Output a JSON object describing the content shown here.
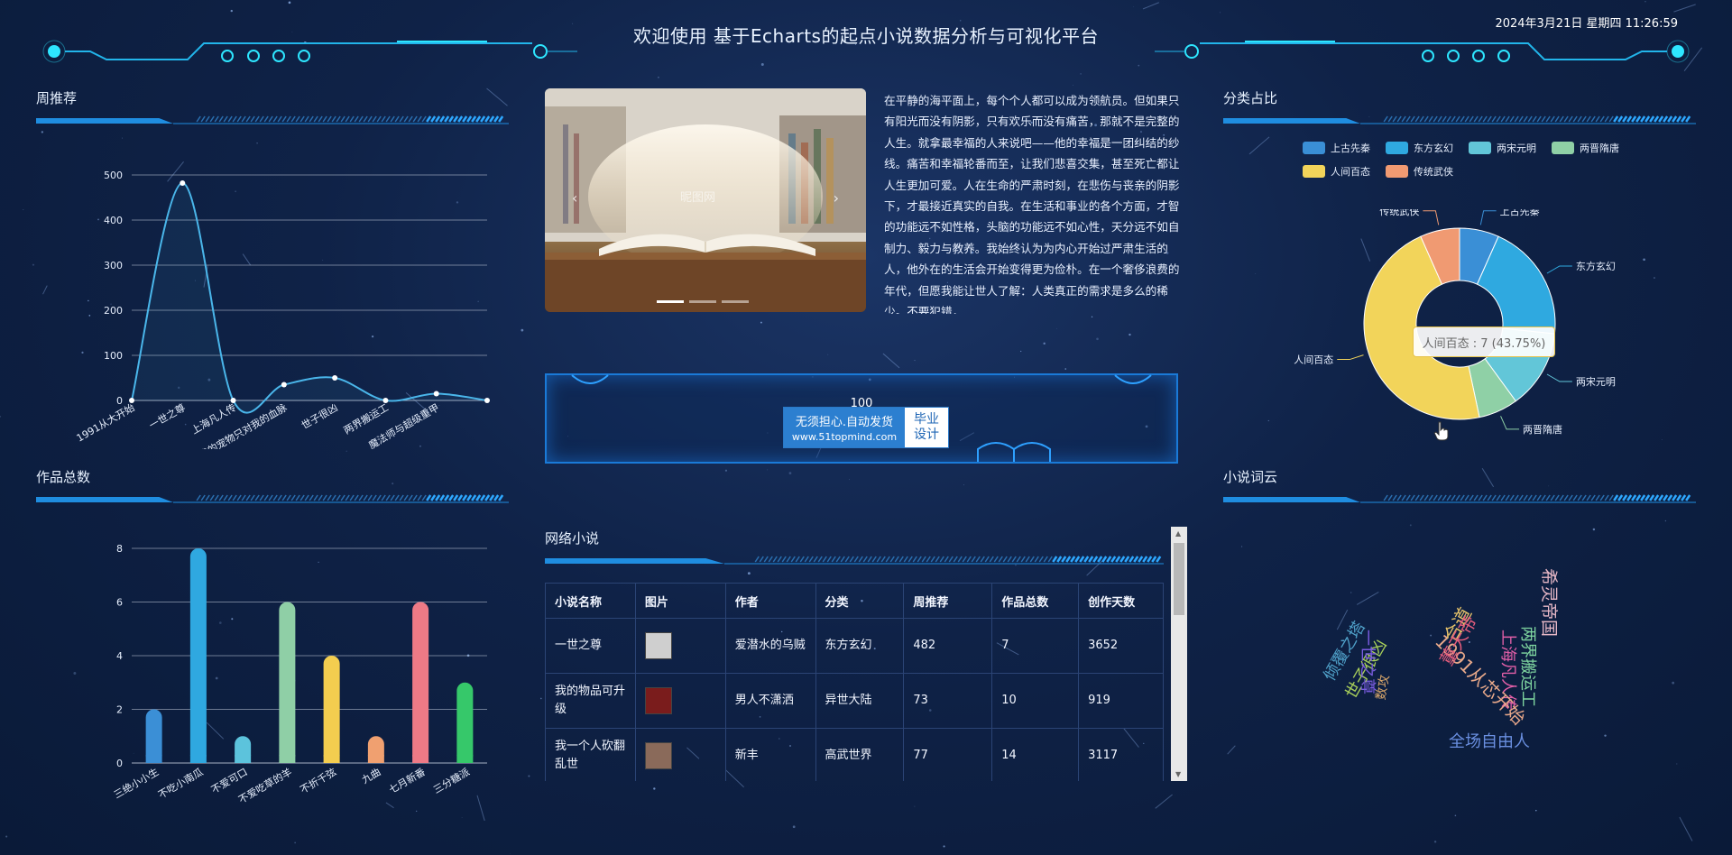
{
  "header": {
    "title": "欢迎使用 基于Echarts的起点小说数据分析与可视化平台",
    "datetime": "2024年3月21日 星期四 11:26:59"
  },
  "panels": {
    "weekly_recommend": "周推荐",
    "works_total": "作品总数",
    "category_share": "分类占比",
    "word_cloud": "小说词云",
    "web_novels": "网络小说"
  },
  "intro_text": "在平静的海平面上，每个个人都可以成为领航员。但如果只有阳光而没有阴影，只有欢乐而没有痛苦，那就不是完整的人生。就拿最幸福的人来说吧——他的幸福是一团纠结的纱线。痛苦和幸福轮番而至，让我们悲喜交集，甚至死亡都让人生更加可爱。人在生命的严肃时刻，在悲伤与丧亲的阴影下，才最接近真实的自我。在生活和事业的各个方面，才智的功能远不如性格，头脑的功能远不如心性，天分远不如自制力、毅力与教养。我始终认为为内心开始过严肃生活的人，他外在的生活会开始变得更为俭朴。在一个奢侈浪费的年代，但愿我能让世人了解：人类真正的需求是多么的稀少。不要犯错，",
  "stat": {
    "number": "100"
  },
  "ad": {
    "line1": "无须担心.自动发货",
    "line2": "www.51topmind.com",
    "right1": "毕业",
    "right2": "设计"
  },
  "carousel": {
    "watermark": "昵图网",
    "arrow_left": "‹",
    "arrow_right": "›"
  },
  "table": {
    "headers": [
      "小说名称",
      "图片",
      "作者",
      "分类",
      "周推荐",
      "作品总数",
      "创作天数"
    ],
    "rows": [
      {
        "name": "一世之尊",
        "author": "爱潜水的乌贼",
        "category": "东方玄幻",
        "weekly": "482",
        "works": "7",
        "days": "3652",
        "thumb_color": "#cfcfcf"
      },
      {
        "name": "我的物品可升级",
        "author": "男人不潇洒",
        "category": "异世大陆",
        "weekly": "73",
        "works": "10",
        "days": "919",
        "thumb_color": "#7a1c1c"
      },
      {
        "name": "我一个人砍翻乱世",
        "author": "新丰",
        "category": "高武世界",
        "weekly": "77",
        "works": "14",
        "days": "3117",
        "thumb_color": "#8a6a5a"
      }
    ]
  },
  "chart_data": [
    {
      "type": "line",
      "categories": [
        "1991从大开始",
        "一世之尊",
        "上海凡人传",
        "我的宠物只对我的血脉",
        "世子很凶",
        "两界搬运工",
        "魔法师与超级重甲",
        ""
      ],
      "values": [
        0,
        482,
        0,
        35,
        50,
        0,
        15,
        0
      ],
      "ylim": [
        0,
        500
      ],
      "yticks": [
        0,
        100,
        200,
        300,
        400,
        500
      ],
      "color": "#4ab6ea"
    },
    {
      "type": "bar",
      "categories": [
        "三绝小小生",
        "不吃小南瓜",
        "不爱可口",
        "不爱吃草的羊",
        "不折千弦",
        "九曲",
        "七月新番",
        "三分糖派"
      ],
      "values": [
        2,
        8,
        1,
        6,
        4,
        1,
        6,
        3
      ],
      "colors": [
        "#3b8fd6",
        "#2fa8e0",
        "#5cc3dc",
        "#8fcfa6",
        "#f3cd4f",
        "#f0a070",
        "#ee7a86",
        "#36c86a"
      ],
      "ylim": [
        0,
        8
      ],
      "yticks": [
        0,
        2,
        4,
        6,
        8
      ]
    },
    {
      "type": "pie",
      "series": [
        {
          "name": "上古先秦",
          "value": 1,
          "color": "#3a8fd6"
        },
        {
          "name": "东方玄幻",
          "value": 3,
          "color": "#2fa9e0"
        },
        {
          "name": "两宋元明",
          "value": 2,
          "color": "#62c6d8"
        },
        {
          "name": "两晋隋唐",
          "value": 1,
          "color": "#8fd0a6"
        },
        {
          "name": "人间百态",
          "value": 7,
          "color": "#f2d45a"
        },
        {
          "name": "传统武侠",
          "value": 1,
          "color": "#f09a72"
        }
      ],
      "tooltip": "人间百态 : 7 (43.75%)"
    }
  ],
  "word_cloud": [
    {
      "text": "希灵帝国",
      "color": "#e6b7c6"
    },
    {
      "text": "两界搬运工",
      "color": "#7fd6a0"
    },
    {
      "text": "上海凡人传",
      "color": "#e35fa8"
    },
    {
      "text": "倾覆之塔",
      "color": "#4fa0c8"
    },
    {
      "text": "世子很凶",
      "color": "#a8cf5a"
    },
    {
      "text": "一世之尊",
      "color": "#7a5ce0"
    },
    {
      "text": "1991从芯开始",
      "color": "#e9a98a"
    },
    {
      "text": "合道",
      "color": "#e8c46a"
    },
    {
      "text": "董天帝",
      "color": "#e25c7c"
    },
    {
      "text": "数攻",
      "color": "#d6a56a"
    },
    {
      "text": "全场自由人",
      "color": "#6a8fe0"
    }
  ]
}
